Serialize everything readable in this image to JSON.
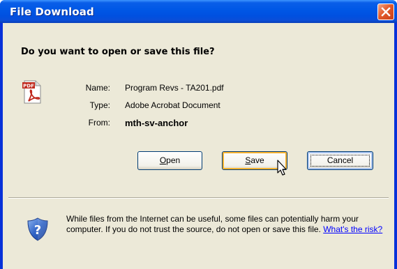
{
  "window": {
    "title": "File Download"
  },
  "dialog": {
    "question": "Do you want to open or save this file?",
    "fields": {
      "name_label": "Name:",
      "name_value": "Program Revs - TA201.pdf",
      "type_label": "Type:",
      "type_value": "Adobe Acrobat Document",
      "from_label": "From:",
      "from_value": "mth-sv-anchor"
    },
    "file_icon": "pdf-file-icon",
    "file_icon_badge": "PDF",
    "buttons": {
      "open": {
        "accel": "O",
        "rest": "pen"
      },
      "save": {
        "accel": "S",
        "rest": "ave"
      },
      "cancel": "Cancel"
    },
    "warning": {
      "icon": "shield-question-icon",
      "text": "While files from the Internet can be useful, some files can potentially harm your computer. If you do not trust the source, do not open or save this file. ",
      "link": "What's the risk?"
    }
  },
  "colors": {
    "titlebar": "#0058e6",
    "close_button": "#e35a2b",
    "dialog_bg": "#ece9d8",
    "link": "#0000ff"
  }
}
